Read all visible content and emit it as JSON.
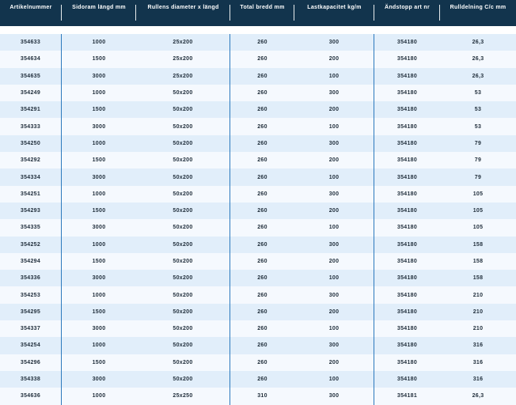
{
  "table": {
    "headers": [
      "Artikelnummer",
      "Sidoram längd mm",
      "Rullens diameter x längd",
      "Total bredd mm",
      "Lastkapacitet kg/m",
      "Ändstopp art nr",
      "Rulldelning C/c mm"
    ],
    "rows": [
      [
        "354633",
        "1000",
        "25x200",
        "260",
        "300",
        "354180",
        "26,3"
      ],
      [
        "354634",
        "1500",
        "25x200",
        "260",
        "200",
        "354180",
        "26,3"
      ],
      [
        "354635",
        "3000",
        "25x200",
        "260",
        "100",
        "354180",
        "26,3"
      ],
      [
        "354249",
        "1000",
        "50x200",
        "260",
        "300",
        "354180",
        "53"
      ],
      [
        "354291",
        "1500",
        "50x200",
        "260",
        "200",
        "354180",
        "53"
      ],
      [
        "354333",
        "3000",
        "50x200",
        "260",
        "100",
        "354180",
        "53"
      ],
      [
        "354250",
        "1000",
        "50x200",
        "260",
        "300",
        "354180",
        "79"
      ],
      [
        "354292",
        "1500",
        "50x200",
        "260",
        "200",
        "354180",
        "79"
      ],
      [
        "354334",
        "3000",
        "50x200",
        "260",
        "100",
        "354180",
        "79"
      ],
      [
        "354251",
        "1000",
        "50x200",
        "260",
        "300",
        "354180",
        "105"
      ],
      [
        "354293",
        "1500",
        "50x200",
        "260",
        "200",
        "354180",
        "105"
      ],
      [
        "354335",
        "3000",
        "50x200",
        "260",
        "100",
        "354180",
        "105"
      ],
      [
        "354252",
        "1000",
        "50x200",
        "260",
        "300",
        "354180",
        "158"
      ],
      [
        "354294",
        "1500",
        "50x200",
        "260",
        "200",
        "354180",
        "158"
      ],
      [
        "354336",
        "3000",
        "50x200",
        "260",
        "100",
        "354180",
        "158"
      ],
      [
        "354253",
        "1000",
        "50x200",
        "260",
        "300",
        "354180",
        "210"
      ],
      [
        "354295",
        "1500",
        "50x200",
        "260",
        "200",
        "354180",
        "210"
      ],
      [
        "354337",
        "3000",
        "50x200",
        "260",
        "100",
        "354180",
        "210"
      ],
      [
        "354254",
        "1000",
        "50x200",
        "260",
        "300",
        "354180",
        "316"
      ],
      [
        "354296",
        "1500",
        "50x200",
        "260",
        "200",
        "354180",
        "316"
      ],
      [
        "354338",
        "3000",
        "50x200",
        "260",
        "100",
        "354180",
        "316"
      ],
      [
        "354636",
        "1000",
        "25x250",
        "310",
        "300",
        "354181",
        "26,3"
      ]
    ]
  },
  "colors": {
    "header_bg": "#12344d",
    "row_even_bg": "#e1eefa",
    "row_odd_bg": "#f5f9fe",
    "divider": "#2c79bd"
  }
}
